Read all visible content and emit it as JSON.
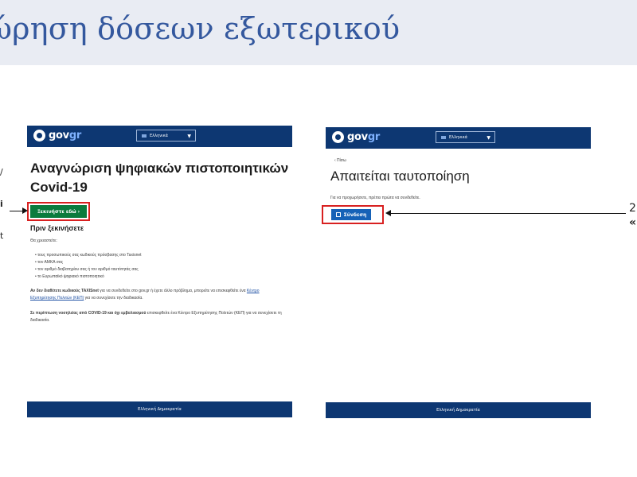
{
  "slide": {
    "title": "ώρηση δόσεων εξωτερικού",
    "left_labels": [
      "/",
      "i",
      "t"
    ],
    "right_labels": [
      "2",
      "«"
    ]
  },
  "left_screen": {
    "logo_text": "gov",
    "logo_accent": "gr",
    "language": "Ελληνικά",
    "heading": "Αναγνώριση ψηφιακών πιστοποιητικών Covid-19",
    "start_button": "Ξεκινήστε εδώ  ›",
    "section_title": "Πριν ξεκινήσετε",
    "need_label": "Θα χρειαστείτε:",
    "bullets": [
      "τους προσωπικούς σας κωδικούς πρόσβασης στο Taxisnet",
      "τον ΑΜΚΑ σας",
      "τον αριθμό διαβατηρίου σας ή τον αριθμό ταυτότητάς σας",
      "το Ευρωπαϊκό ψηφιακό πιστοποιητικό"
    ],
    "para1_bold": "Αν δεν διαθέτετε κωδικούς TAXISnet",
    "para1_rest": " για να συνδεθείτε στο gov.gr ή έχετε άλλο πρόβλημα, μπορείτε να επισκεφθείτε ένα ",
    "para1_link": "Κέντρο Εξυπηρέτησης Πολιτών (ΚΕΠ)",
    "para1_end": " για να συνεχίσετε την διαδικασία.",
    "para2_bold": "Σε περίπτωση νοσηλείας από COVID-19 και όχι εμβολιασμού",
    "para2_rest": " επισκεφθείτε ένα Κέντρο Εξυπηρέτησης Πολιτών (ΚΕΠ) για να συνεχίσετε τη διαδικασία.",
    "footer": "Ελληνική Δημοκρατία"
  },
  "right_screen": {
    "logo_text": "gov",
    "logo_accent": "gr",
    "language": "Ελληνικά",
    "back_link": "‹ Πίσω",
    "heading": "Απαιτείται ταυτοποίηση",
    "instruction": "Για να προχωρήσετε, πρέπει πρώτα να συνδεθείτε.",
    "login_button": "Σύνδεση",
    "footer": "Ελληνική Δημοκρατία"
  },
  "colors": {
    "gov_blue": "#0d3772",
    "start_green": "#0a7b3d",
    "login_blue": "#1662b7",
    "highlight_red": "#d82020",
    "title_blue": "#34589e"
  }
}
